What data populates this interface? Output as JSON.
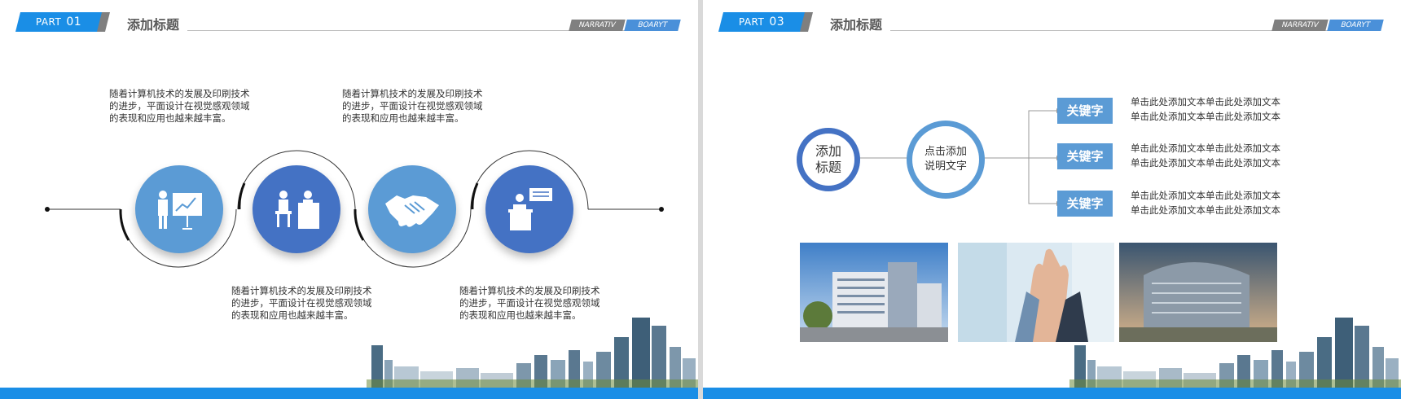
{
  "slides": [
    {
      "part_label": "PART",
      "part_number": "01",
      "title": "添加标题",
      "corner_tags": [
        "NARRATIV",
        "BOARYT"
      ],
      "paragraphs": [
        "随着计算机技术的发展及印刷技术的进步，平面设计在视觉感观领域的表现和应用也越来越丰富。",
        "随着计算机技术的发展及印刷技术的进步，平面设计在视觉感观领域的表现和应用也越来越丰富。",
        "随着计算机技术的发展及印刷技术的进步，平面设计在视觉感观领域的表现和应用也越来越丰富。",
        "随着计算机技术的发展及印刷技术的进步，平面设计在视觉感观领域的表现和应用也越来越丰富。"
      ],
      "icons": [
        "presentation-icon",
        "meeting-icon",
        "handshake-icon",
        "speaker-icon"
      ]
    },
    {
      "part_label": "PART",
      "part_number": "03",
      "title": "添加标题",
      "corner_tags": [
        "NARRATIV",
        "BOARYT"
      ],
      "left_circle": "添加标题",
      "center_circle": "点击添加说明文字",
      "keywords": [
        {
          "label": "关键字",
          "lines": [
            "单击此处添加文本单击此处添加文本",
            "单击此处添加文本单击此处添加文本"
          ]
        },
        {
          "label": "关键字",
          "lines": [
            "单击此处添加文本单击此处添加文本",
            "单击此处添加文本单击此处添加文本"
          ]
        },
        {
          "label": "关键字",
          "lines": [
            "单击此处添加文本单击此处添加文本",
            "单击此处添加文本单击此处添加文本"
          ]
        }
      ],
      "photos": [
        "office-building-photo",
        "hands-together-photo",
        "modern-building-photo"
      ]
    }
  ],
  "colors": {
    "accent": "#1a8ee6",
    "light_blue": "#5b9bd5",
    "dark_blue": "#4472c4",
    "gray": "#808080"
  }
}
